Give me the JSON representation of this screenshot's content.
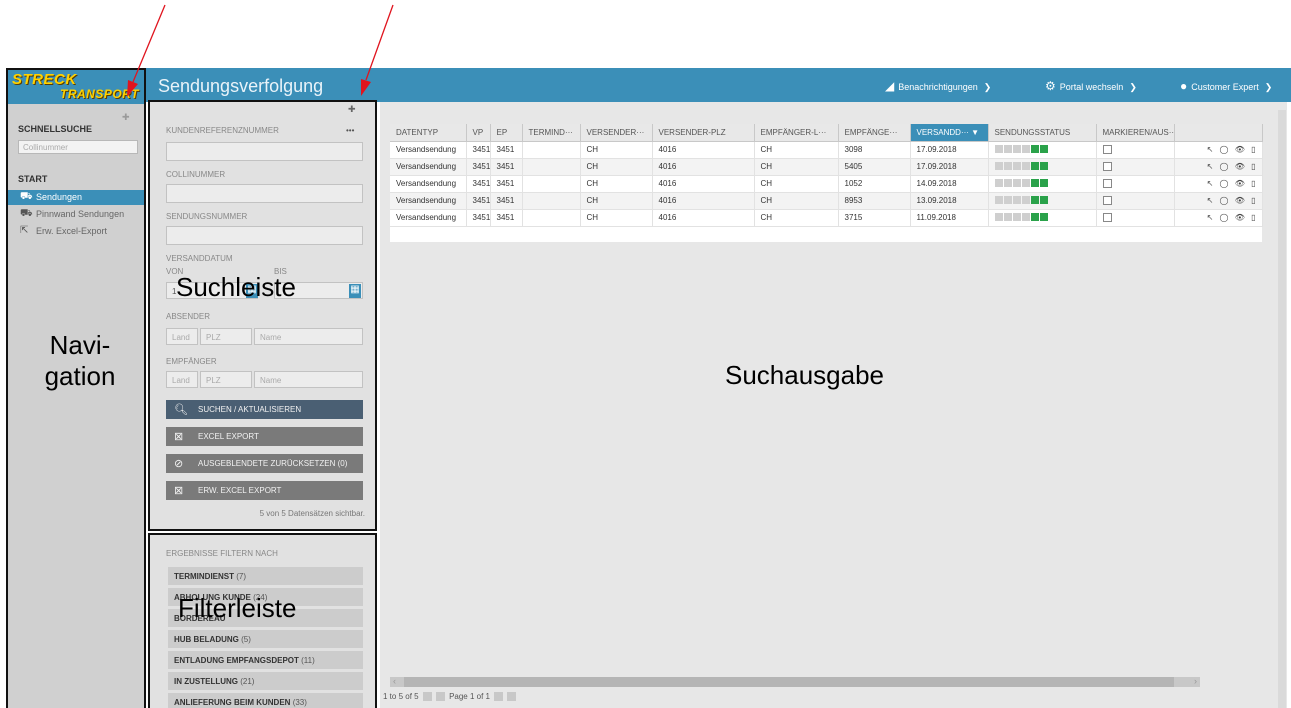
{
  "annotations": {
    "navigation": "Navi-\ngation",
    "search_bar": "Suchleiste",
    "filter_bar": "Filterleiste",
    "results": "Suchausgabe"
  },
  "logo": {
    "line1": "STRECK",
    "line2": "TRANSPORT"
  },
  "nav": {
    "quick_search_heading": "SCHNELLSUCHE",
    "quick_search_placeholder": "Collinummer",
    "start_heading": "START",
    "items": [
      {
        "label": "Sendungen",
        "icon": "truck-icon",
        "active": true
      },
      {
        "label": "Pinnwand Sendungen",
        "icon": "truck-icon",
        "active": false
      },
      {
        "label": "Erw. Excel-Export",
        "icon": "export-icon",
        "active": false
      }
    ]
  },
  "header": {
    "title": "Sendungsverfolgung",
    "notifications": "Benachrichtigungen",
    "portal_switch": "Portal wechseln",
    "user": "Customer Expert"
  },
  "search": {
    "customer_ref_label": "KUNDENREFERENZNUMMER",
    "more_label": "•••",
    "colli_label": "COLLINUMMER",
    "shipment_no_label": "SENDUNGSNUMMER",
    "ship_date_label": "VERSANDDATUM",
    "from_label": "VON",
    "to_label": "BIS",
    "from_value": "1",
    "sender_label": "ABSENDER",
    "recipient_label": "EMPFÄNGER",
    "land_placeholder": "Land",
    "plz_placeholder": "PLZ",
    "name_placeholder": "Name",
    "search_button": "SUCHEN / AKTUALISIEREN",
    "excel_button": "EXCEL EXPORT",
    "reset_hidden_button": "AUSGEBLENDETE ZURÜCKSETZEN (0)",
    "ext_excel_button": "ERW. EXCEL EXPORT",
    "records_visible": "5 von 5 Datensätzen sichtbar."
  },
  "filters": {
    "heading": "ERGEBNISSE FILTERN NACH",
    "items": [
      {
        "label": "TERMINDIENST",
        "count": "(7)"
      },
      {
        "label": "ABHOLUNG KUNDE",
        "count": "(24)"
      },
      {
        "label": "BORDEREAU",
        "count": ""
      },
      {
        "label": "HUB BELADUNG",
        "count": "(5)"
      },
      {
        "label": "ENTLADUNG EMPFANGSDEPOT",
        "count": "(11)"
      },
      {
        "label": "IN ZUSTELLUNG",
        "count": "(21)"
      },
      {
        "label": "ANLIEFERUNG BEIM KUNDEN",
        "count": "(33)"
      }
    ]
  },
  "grid": {
    "columns": [
      "DATENTYP",
      "VP",
      "EP",
      "TERMIND···",
      "VERSENDER···",
      "VERSENDER-PLZ",
      "EMPFÄNGER-L···",
      "EMPFÄNGE···",
      "VERSANDD···",
      "SENDUNGSSTATUS",
      "MARKIEREN/AUS···",
      ""
    ],
    "sorted_column_index": 8,
    "rows": [
      {
        "datentyp": "Versandsendung",
        "vp": "3451",
        "ep": "3451",
        "termin": "",
        "versender": "CH",
        "versender_plz": "4016",
        "empfaenger_land": "CH",
        "empfaenger_plz": "3098",
        "datum": "17.09.2018",
        "status_level": 4
      },
      {
        "datentyp": "Versandsendung",
        "vp": "3451",
        "ep": "3451",
        "termin": "",
        "versender": "CH",
        "versender_plz": "4016",
        "empfaenger_land": "CH",
        "empfaenger_plz": "5405",
        "datum": "17.09.2018",
        "status_level": 4
      },
      {
        "datentyp": "Versandsendung",
        "vp": "3451",
        "ep": "3451",
        "termin": "",
        "versender": "CH",
        "versender_plz": "4016",
        "empfaenger_land": "CH",
        "empfaenger_plz": "1052",
        "datum": "14.09.2018",
        "status_level": 4
      },
      {
        "datentyp": "Versandsendung",
        "vp": "3451",
        "ep": "3451",
        "termin": "",
        "versender": "CH",
        "versender_plz": "4016",
        "empfaenger_land": "CH",
        "empfaenger_plz": "8953",
        "datum": "13.09.2018",
        "status_level": 4
      },
      {
        "datentyp": "Versandsendung",
        "vp": "3451",
        "ep": "3451",
        "termin": "",
        "versender": "CH",
        "versender_plz": "4016",
        "empfaenger_land": "CH",
        "empfaenger_plz": "3715",
        "datum": "11.09.2018",
        "status_level": 4
      }
    ],
    "status_segments": 6,
    "row_icons": "↖ ◯ 👁 ▯"
  },
  "pager": {
    "range": "1 to 5 of 5",
    "page": "Page 1 of 1"
  },
  "colors": {
    "accent": "#3b8fb8",
    "status_green": "#2aa24a",
    "panel_gray": "#e1e1e1"
  }
}
